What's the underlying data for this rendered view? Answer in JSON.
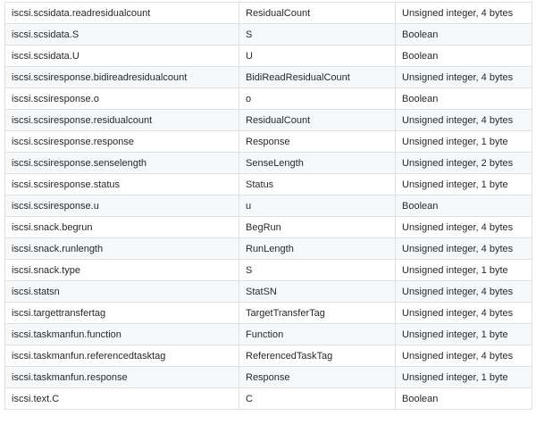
{
  "table": {
    "rows": [
      {
        "field": "iscsi.scsidata.readresidualcount",
        "description": "ResidualCount",
        "type": "Unsigned integer, 4 bytes"
      },
      {
        "field": "iscsi.scsidata.S",
        "description": "S",
        "type": "Boolean"
      },
      {
        "field": "iscsi.scsidata.U",
        "description": "U",
        "type": "Boolean"
      },
      {
        "field": "iscsi.scsiresponse.bidireadresidualcount",
        "description": "BidiReadResidualCount",
        "type": "Unsigned integer, 4 bytes"
      },
      {
        "field": "iscsi.scsiresponse.o",
        "description": "o",
        "type": "Boolean"
      },
      {
        "field": "iscsi.scsiresponse.residualcount",
        "description": "ResidualCount",
        "type": "Unsigned integer, 4 bytes"
      },
      {
        "field": "iscsi.scsiresponse.response",
        "description": "Response",
        "type": "Unsigned integer, 1 byte"
      },
      {
        "field": "iscsi.scsiresponse.senselength",
        "description": "SenseLength",
        "type": "Unsigned integer, 2 bytes"
      },
      {
        "field": "iscsi.scsiresponse.status",
        "description": "Status",
        "type": "Unsigned integer, 1 byte"
      },
      {
        "field": "iscsi.scsiresponse.u",
        "description": "u",
        "type": "Boolean"
      },
      {
        "field": "iscsi.snack.begrun",
        "description": "BegRun",
        "type": "Unsigned integer, 4 bytes"
      },
      {
        "field": "iscsi.snack.runlength",
        "description": "RunLength",
        "type": "Unsigned integer, 4 bytes"
      },
      {
        "field": "iscsi.snack.type",
        "description": "S",
        "type": "Unsigned integer, 1 byte"
      },
      {
        "field": "iscsi.statsn",
        "description": "StatSN",
        "type": "Unsigned integer, 4 bytes"
      },
      {
        "field": "iscsi.targettransfertag",
        "description": "TargetTransferTag",
        "type": "Unsigned integer, 4 bytes"
      },
      {
        "field": "iscsi.taskmanfun.function",
        "description": "Function",
        "type": "Unsigned integer, 1 byte"
      },
      {
        "field": "iscsi.taskmanfun.referencedtasktag",
        "description": "ReferencedTaskTag",
        "type": "Unsigned integer, 4 bytes"
      },
      {
        "field": "iscsi.taskmanfun.response",
        "description": "Response",
        "type": "Unsigned integer, 1 byte"
      },
      {
        "field": "iscsi.text.C",
        "description": "C",
        "type": "Boolean"
      }
    ]
  }
}
